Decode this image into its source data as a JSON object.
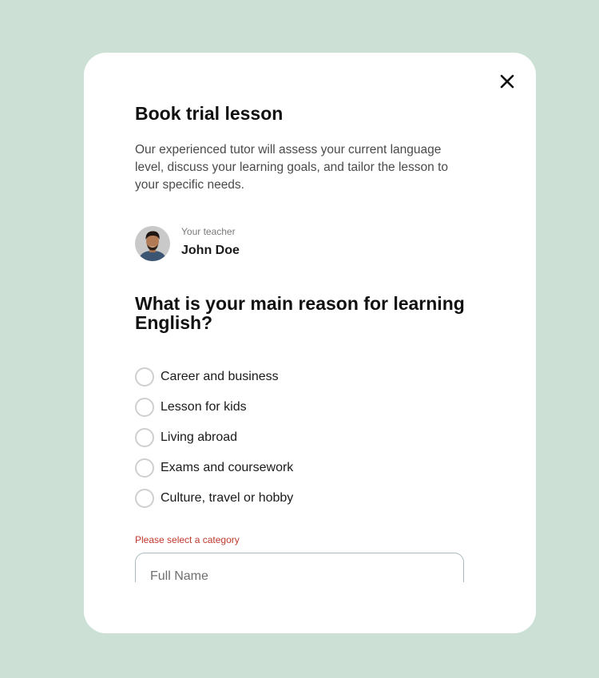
{
  "modal": {
    "close_icon": "close-icon",
    "title": "Book trial lesson",
    "description": "Our experienced tutor will assess your current language level, discuss your learning goals, and tailor the lesson to your specific needs."
  },
  "teacher": {
    "caption": "Your teacher",
    "name": "John Doe"
  },
  "question": {
    "text": "What is your main reason for learning English?",
    "options": [
      {
        "label": "Career and business",
        "selected": false
      },
      {
        "label": "Lesson for kids",
        "selected": false
      },
      {
        "label": "Living abroad",
        "selected": false
      },
      {
        "label": "Exams and coursework",
        "selected": false
      },
      {
        "label": "Culture, travel or hobby",
        "selected": false
      }
    ]
  },
  "form": {
    "error_text": "Please select a category",
    "full_name_placeholder": "Full Name",
    "full_name_value": ""
  },
  "colors": {
    "page_background": "#cde0d6",
    "modal_background": "#ffffff",
    "error": "#c0392b",
    "radio_border": "#cfcfcf",
    "input_border": "#a9bcc0"
  }
}
